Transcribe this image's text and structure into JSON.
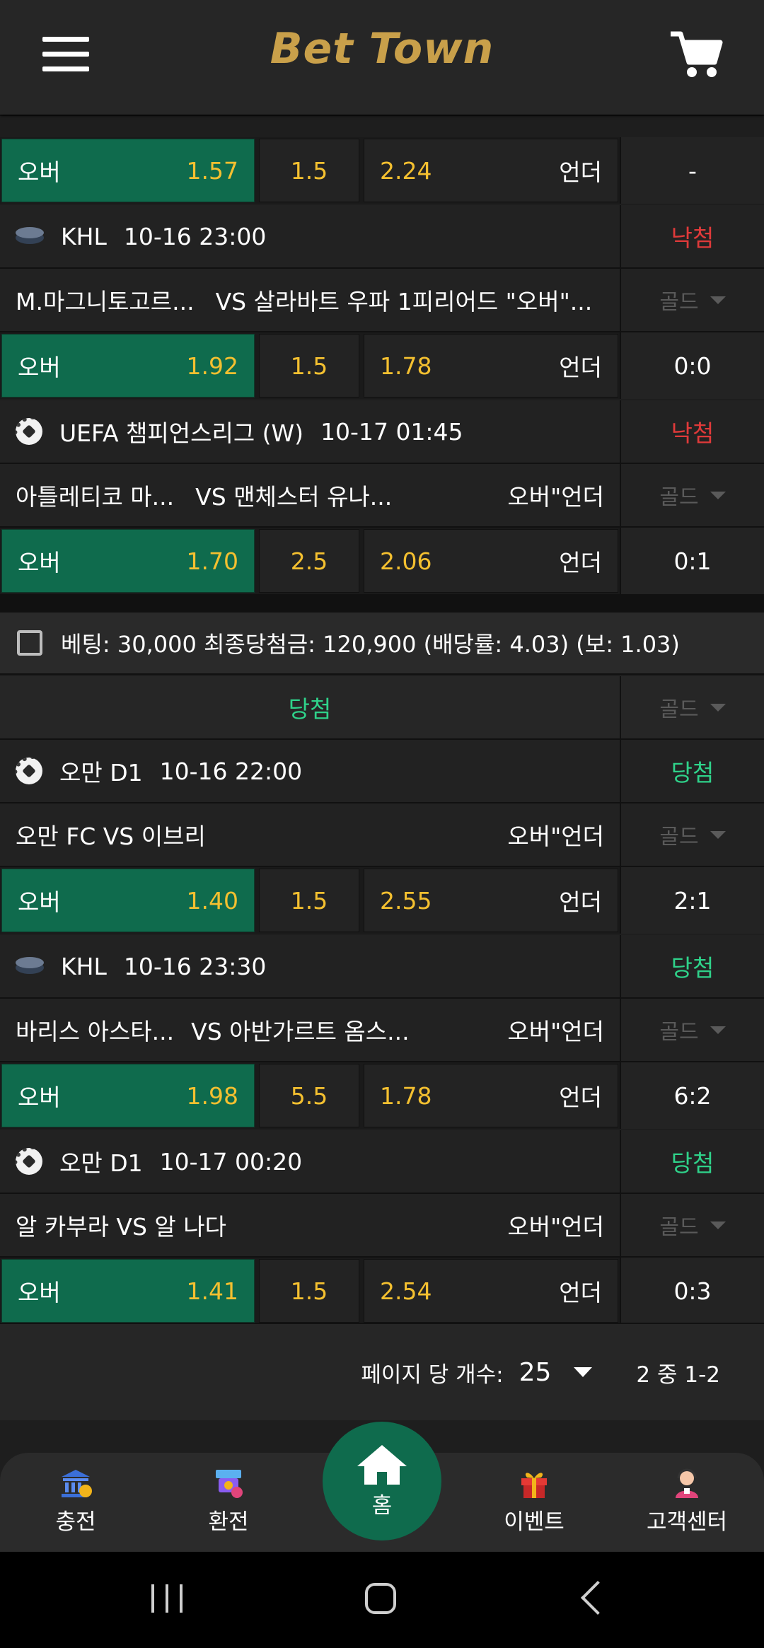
{
  "header": {
    "logo_text": "Bet Town"
  },
  "colors": {
    "accent_green": "#0f6b4d",
    "odds_gold": "#f4c030",
    "lost_red": "#e03a3a",
    "won_green": "#2fd28a",
    "logo_gold": "#c9a04a"
  },
  "slip1": {
    "row0": {
      "over_label": "오버",
      "over_odds": "1.57",
      "line": "1.5",
      "under_odds": "2.24",
      "under_label": "언더",
      "score": "-"
    },
    "game1": {
      "icon": "hockey-puck-icon",
      "league": "KHL",
      "time": "10-16 23:00",
      "status": "낙첨",
      "teams": "M.마그니토고르...",
      "vs": "VS 살라바트 우파 1피리어드 \"오버\"...",
      "gold": "골드",
      "over_label": "오버",
      "over_odds": "1.92",
      "line": "1.5",
      "under_odds": "1.78",
      "under_label": "언더",
      "score": "0:0"
    },
    "game2": {
      "icon": "soccer-ball-icon",
      "league": "UEFA 챔피언스리그 (W)",
      "time": "10-17 01:45",
      "status": "낙첨",
      "teams": "아틀레티코 마...",
      "vs": "VS 맨체스터 유나...",
      "market": "오버\"언더",
      "gold": "골드",
      "over_label": "오버",
      "over_odds": "1.70",
      "line": "2.5",
      "under_odds": "2.06",
      "under_label": "언더",
      "score": "0:1"
    }
  },
  "slip2": {
    "summary": "베팅: 30,000 최종당첨금: 120,900 (배당률: 4.03) (보: 1.03)",
    "result": "당첨",
    "result_gold": "골드",
    "game1": {
      "icon": "soccer-ball-icon",
      "league": "오만 D1",
      "time": "10-16 22:00",
      "status": "당첨",
      "teams": "오만 FC VS 이브리",
      "market": "오버\"언더",
      "gold": "골드",
      "over_label": "오버",
      "over_odds": "1.40",
      "line": "1.5",
      "under_odds": "2.55",
      "under_label": "언더",
      "score": "2:1"
    },
    "game2": {
      "icon": "hockey-puck-icon",
      "league": "KHL",
      "time": "10-16 23:30",
      "status": "당첨",
      "teams": "바리스 아스타...",
      "vs": "VS 아반가르트 옴스...",
      "market": "오버\"언더",
      "gold": "골드",
      "over_label": "오버",
      "over_odds": "1.98",
      "line": "5.5",
      "under_odds": "1.78",
      "under_label": "언더",
      "score": "6:2"
    },
    "game3": {
      "icon": "soccer-ball-icon",
      "league": "오만 D1",
      "time": "10-17 00:20",
      "status": "당첨",
      "teams": "알 카부라 VS 알 나다",
      "market": "오버\"언더",
      "gold": "골드",
      "over_label": "오버",
      "over_odds": "1.41",
      "line": "1.5",
      "under_odds": "2.54",
      "under_label": "언더",
      "score": "0:3"
    }
  },
  "pagination": {
    "per_page_label": "페이지 당 개수:",
    "per_page_value": "25",
    "range": "2 중 1-2"
  },
  "bottom_nav": {
    "deposit": "충전",
    "withdraw": "환전",
    "home": "홈",
    "event": "이벤트",
    "support": "고객센터"
  }
}
